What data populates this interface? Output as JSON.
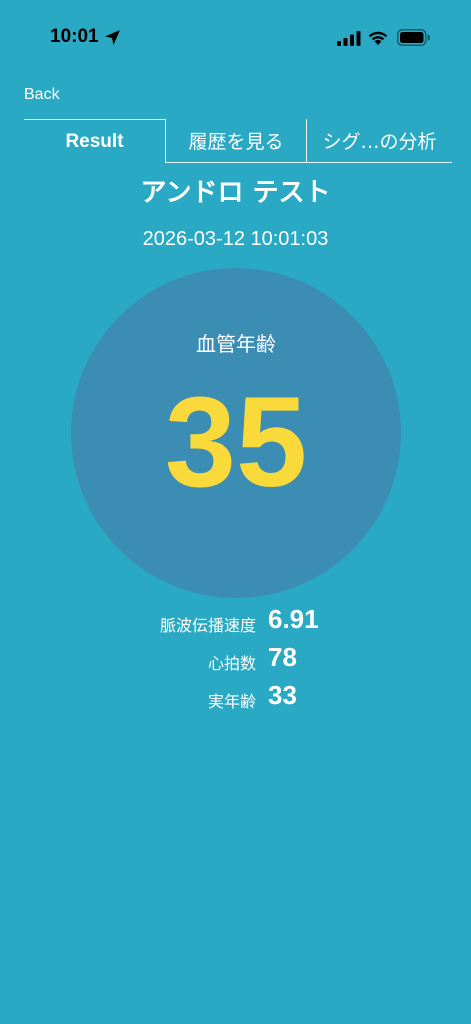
{
  "status_bar": {
    "time": "10:01"
  },
  "nav": {
    "back_label": "Back"
  },
  "tabs": [
    {
      "label": "Result"
    },
    {
      "label": "履歴を見る"
    },
    {
      "label": "シグ…の分析"
    }
  ],
  "result": {
    "user_name": "アンドロ テスト",
    "datetime": "2026-03-12 10:01:03",
    "circle_label": "血管年齢",
    "vascular_age": "35"
  },
  "metrics": [
    {
      "label": "脈波伝播速度",
      "value": "6.91"
    },
    {
      "label": "心拍数",
      "value": "78"
    },
    {
      "label": "実年齢",
      "value": "33"
    }
  ],
  "colors": {
    "background": "#2aa9c4",
    "circle": "#3b8db4",
    "accent_value": "#fad93a"
  },
  "icons": {
    "location": "location-arrow-icon",
    "signal": "cellular-signal-icon",
    "wifi": "wifi-icon",
    "battery": "battery-icon"
  }
}
